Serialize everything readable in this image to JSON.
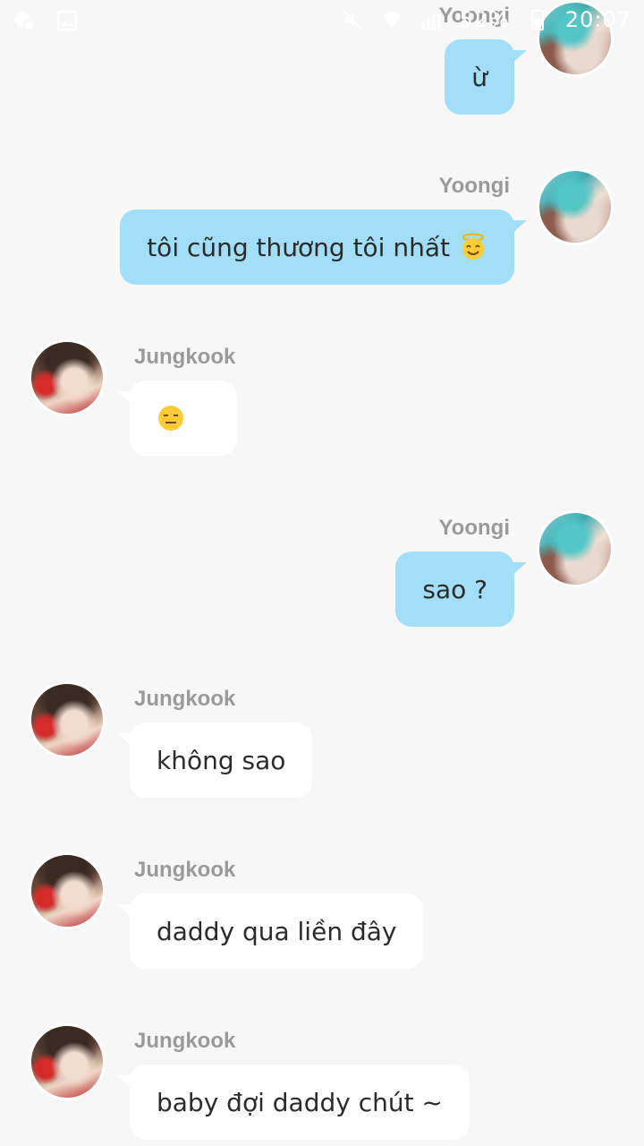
{
  "status_bar": {
    "battery_percent": "52%",
    "time": "20:07",
    "icons": [
      "messenger-icon",
      "gallery-icon",
      "mute-icon",
      "wifi-icon",
      "signal-icon",
      "battery-icon"
    ]
  },
  "participants": {
    "right": "Yoongi",
    "left": "Jungkook"
  },
  "messages": [
    {
      "sender": "Yoongi",
      "side": "right",
      "text": "ừ",
      "emoji": ""
    },
    {
      "sender": "Yoongi",
      "side": "right",
      "text": "tôi cũng thương tôi nhất",
      "emoji": "smiling-face-with-halo"
    },
    {
      "sender": "Jungkook",
      "side": "left",
      "text": "",
      "emoji": "expressionless-face"
    },
    {
      "sender": "Yoongi",
      "side": "right",
      "text": "sao ?",
      "emoji": ""
    },
    {
      "sender": "Jungkook",
      "side": "left",
      "text": "không sao",
      "emoji": ""
    },
    {
      "sender": "Jungkook",
      "side": "left",
      "text": "daddy qua liền đây",
      "emoji": ""
    },
    {
      "sender": "Jungkook",
      "side": "left",
      "text": "baby đợi daddy chút ~",
      "emoji": ""
    }
  ],
  "colors": {
    "background": "#f7f7f7",
    "outgoing_bubble": "#a3def8",
    "incoming_bubble": "#ffffff",
    "sender_name": "#9a9a9a",
    "text": "#2b2b2b"
  }
}
